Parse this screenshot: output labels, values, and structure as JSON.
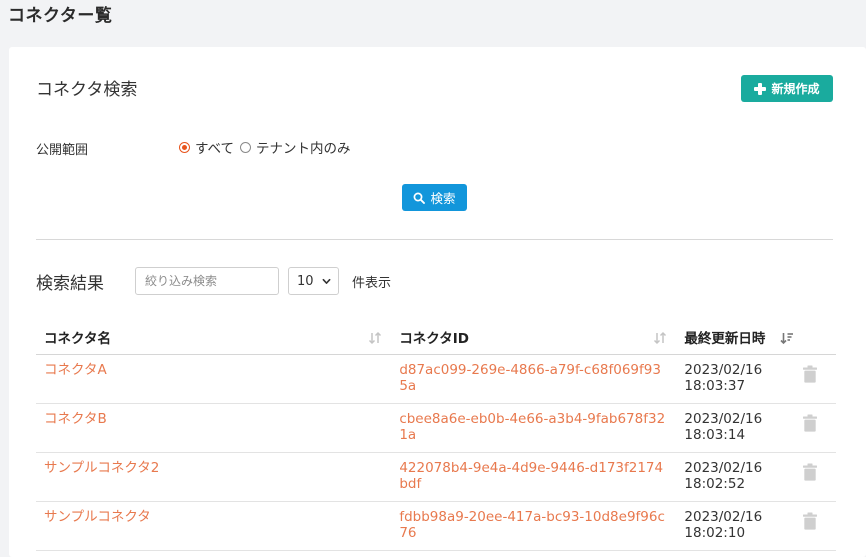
{
  "page": {
    "title": "コネクター覧"
  },
  "search": {
    "title": "コネクタ検索",
    "new_button_label": "新規作成",
    "scope_label": "公開範囲",
    "scope_options": [
      {
        "label": "すべて",
        "checked": true
      },
      {
        "label": "テナント内のみ",
        "checked": false
      }
    ],
    "search_button_label": "検索"
  },
  "results": {
    "title": "検索結果",
    "filter_placeholder": "絞り込み検索",
    "page_size": "10",
    "page_size_suffix": "件表示",
    "columns": {
      "name": "コネクタ名",
      "id": "コネクタID",
      "updated": "最終更新日時"
    },
    "rows": [
      {
        "name": "コネクタA",
        "id": "d87ac099-269e-4866-a79f-c68f069f935a",
        "date": "2023/02/16",
        "time": "18:03:37"
      },
      {
        "name": "コネクタB",
        "id": "cbee8a6e-eb0b-4e66-a3b4-9fab678f321a",
        "date": "2023/02/16",
        "time": "18:03:14"
      },
      {
        "name": "サンプルコネクタ2",
        "id": "422078b4-9e4a-4d9e-9446-d173f2174bdf",
        "date": "2023/02/16",
        "time": "18:02:52"
      },
      {
        "name": "サンプルコネクタ",
        "id": "fdbb98a9-20ee-417a-bc93-10d8e9f96c76",
        "date": "2023/02/16",
        "time": "18:02:10"
      }
    ]
  },
  "colors": {
    "accent_green": "#1aab9e",
    "accent_blue": "#1296db",
    "link_orange": "#e8794e",
    "radio_checked": "#e8551e"
  },
  "icons": {
    "new_button": "plus-icon",
    "search_button": "search-icon",
    "sort": "sort-icon",
    "sort_active": "sort-desc-icon",
    "row_action": "trash-icon",
    "select": "chevron-down-icon"
  }
}
